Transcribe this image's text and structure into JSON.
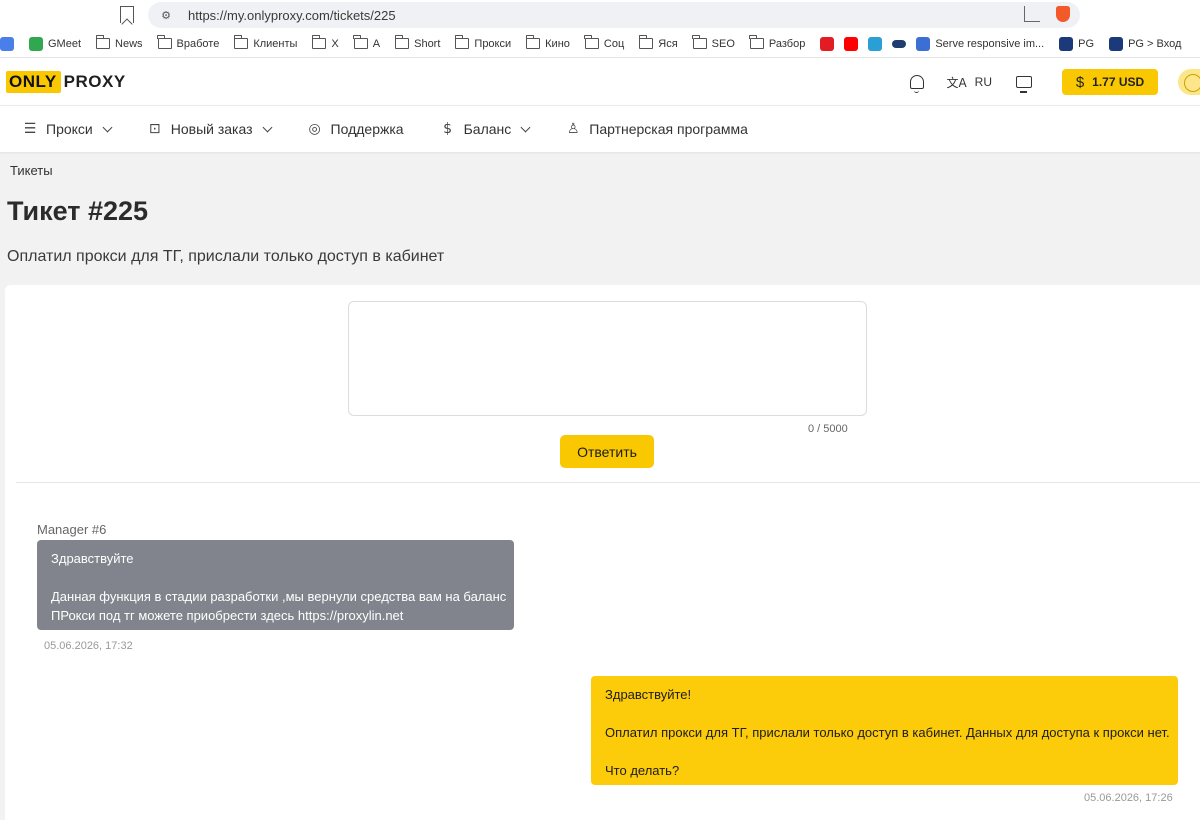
{
  "browser": {
    "url": "https://my.onlyproxy.com/tickets/225",
    "bookmarks": [
      "GMeet",
      "News",
      "Вработе",
      "Клиенты",
      "X",
      "A",
      "Short",
      "Прокси",
      "Кино",
      "Соц",
      "Яся",
      "SEO",
      "Разбор",
      "Serve responsive im...",
      "PG",
      "PG > Вход"
    ]
  },
  "header": {
    "logo_left": "ONLY",
    "logo_right": "PROXY",
    "language": "RU",
    "balance": "1.77 USD",
    "balance_currency_symbol": "$"
  },
  "nav": {
    "items": [
      {
        "label": "Прокси",
        "icon": "list-icon"
      },
      {
        "label": "Новый заказ",
        "icon": "basket-icon"
      },
      {
        "label": "Поддержка",
        "icon": "lifebuoy-icon"
      },
      {
        "label": "Баланс",
        "icon": "dollar-icon"
      },
      {
        "label": "Партнерская программа",
        "icon": "award-icon"
      }
    ]
  },
  "page": {
    "breadcrumb": "Тикеты",
    "title": "Тикет #225",
    "subject": "Оплатил прокси для ТГ, прислали только доступ в кабинет"
  },
  "reply": {
    "value": "",
    "counter": "0 / 5000",
    "button_label": "Ответить"
  },
  "messages": [
    {
      "author": "Manager #6",
      "lines": [
        "Здравствуйте",
        "",
        "Данная функция в стадии разработки ,мы вернули средства вам на баланс",
        "ПРокси под тг можете приобрести здесь https://proxylin.net"
      ],
      "time": "05.06.2026, 17:32"
    },
    {
      "author": "",
      "lines": [
        "Здравствуйте!",
        "",
        "Оплатил прокси для ТГ, прислали только доступ в кабинет. Данных для доступа к прокси нет.",
        "",
        "Что делать?"
      ],
      "time": "05.06.2026, 17:26"
    }
  ],
  "colors": {
    "accent": "#f9c800",
    "manager_bubble": "#81848c",
    "user_bubble": "#fccb0a"
  }
}
